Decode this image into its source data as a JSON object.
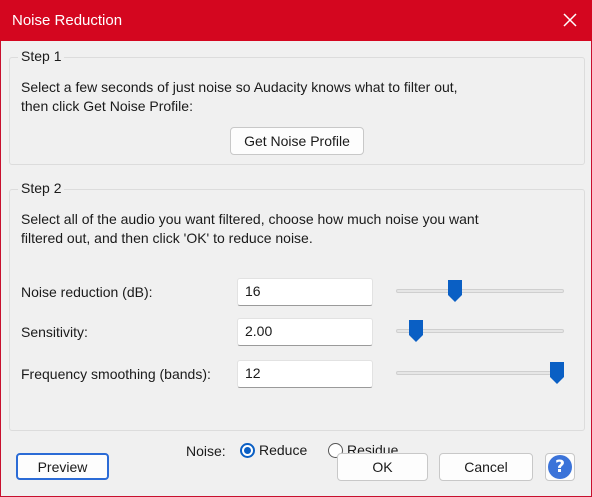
{
  "window": {
    "title": "Noise Reduction"
  },
  "step1": {
    "legend": "Step 1",
    "line1": "Select a few seconds of just noise so Audacity knows what to filter out,",
    "line2": "then click Get Noise Profile:",
    "button": "Get Noise Profile"
  },
  "step2": {
    "legend": "Step 2",
    "line1": "Select all of the audio you want filtered, choose how much noise you want",
    "line2": "filtered out, and then click 'OK' to reduce noise.",
    "noise_reduction": {
      "label": "Noise reduction (dB):",
      "value": "16",
      "slider_fraction": 0.35
    },
    "sensitivity": {
      "label": "Sensitivity:",
      "value": "2.00",
      "slider_fraction": 0.12
    },
    "frequency_smoothing": {
      "label": "Frequency smoothing (bands):",
      "value": "12",
      "slider_fraction": 0.96
    },
    "noise": {
      "label": "Noise:",
      "options": [
        "Reduce",
        "Residue"
      ],
      "selected": "Reduce"
    }
  },
  "footer": {
    "preview": "Preview",
    "ok": "OK",
    "cancel": "Cancel"
  },
  "colors": {
    "titlebar": "#d4061f",
    "accent": "#0a5fc4",
    "help": "#3b73d9"
  },
  "icons": {
    "close": "close-icon",
    "help": "help-icon"
  }
}
